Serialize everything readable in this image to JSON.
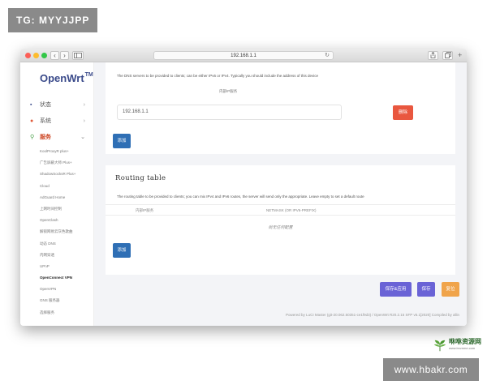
{
  "watermark": {
    "top_tag": "TG: MYYJJPP",
    "bottom_tag": "www.hbakr.com",
    "logo_brand": "咻咻资源网",
    "logo_site": "www.bxvnme.com"
  },
  "browser": {
    "url": "192.168.1.1",
    "back_label": "‹",
    "forward_label": "›",
    "reload_label": "↻"
  },
  "sidebar": {
    "logo": "OpenWrt",
    "logo_tm": "TM",
    "menu": [
      {
        "label": "状态",
        "icon": "grid-icon"
      },
      {
        "label": "系统",
        "icon": "gear-icon"
      },
      {
        "label": "服务",
        "icon": "link-icon"
      }
    ],
    "sub_items": [
      "KoolProxyR plus+",
      "广告屏蔽大师 Plus+",
      "ShadowSocksR Plus+",
      "Cloud",
      "AdGuard Home",
      "上网时间控制",
      "OpenClash",
      "解锁网易云灰色歌曲",
      "动态 DNS",
      "内网穿透",
      "UPnP",
      "OpenConnect VPN",
      "OpenVPN",
      "GNS 服务器",
      "选择服务"
    ],
    "current_sub": "OpenConnect VPN"
  },
  "dns_section": {
    "description": "The DNS servers to be provided to clients; can be either IPv6 or IPv4. Typically you should include the address of this device",
    "column_header": "内部IP服务",
    "ip_value": "192.168.1.1",
    "delete_label": "删除",
    "add_label": "添加"
  },
  "routing_section": {
    "title": "Routing table",
    "description": "The routing table to be provided to clients; you can mix IPv4 and IPv6 routes, the server will send only the appropriate. Leave empty to set a default route",
    "col1": "内部IP服务",
    "col2": "NETMASK (OR IPV6-PREFIX)",
    "empty_text": "尚无任何配置",
    "add_label": "添加"
  },
  "actions": {
    "save_apply": "保存&应用",
    "save": "保存",
    "reset": "复位"
  },
  "footer": "Powered by LuCI Master (git-20.062.50351-ce1f9d3) / OpenWrt R20.2.15 SFP v5.1[2020] Compiled by allin"
}
